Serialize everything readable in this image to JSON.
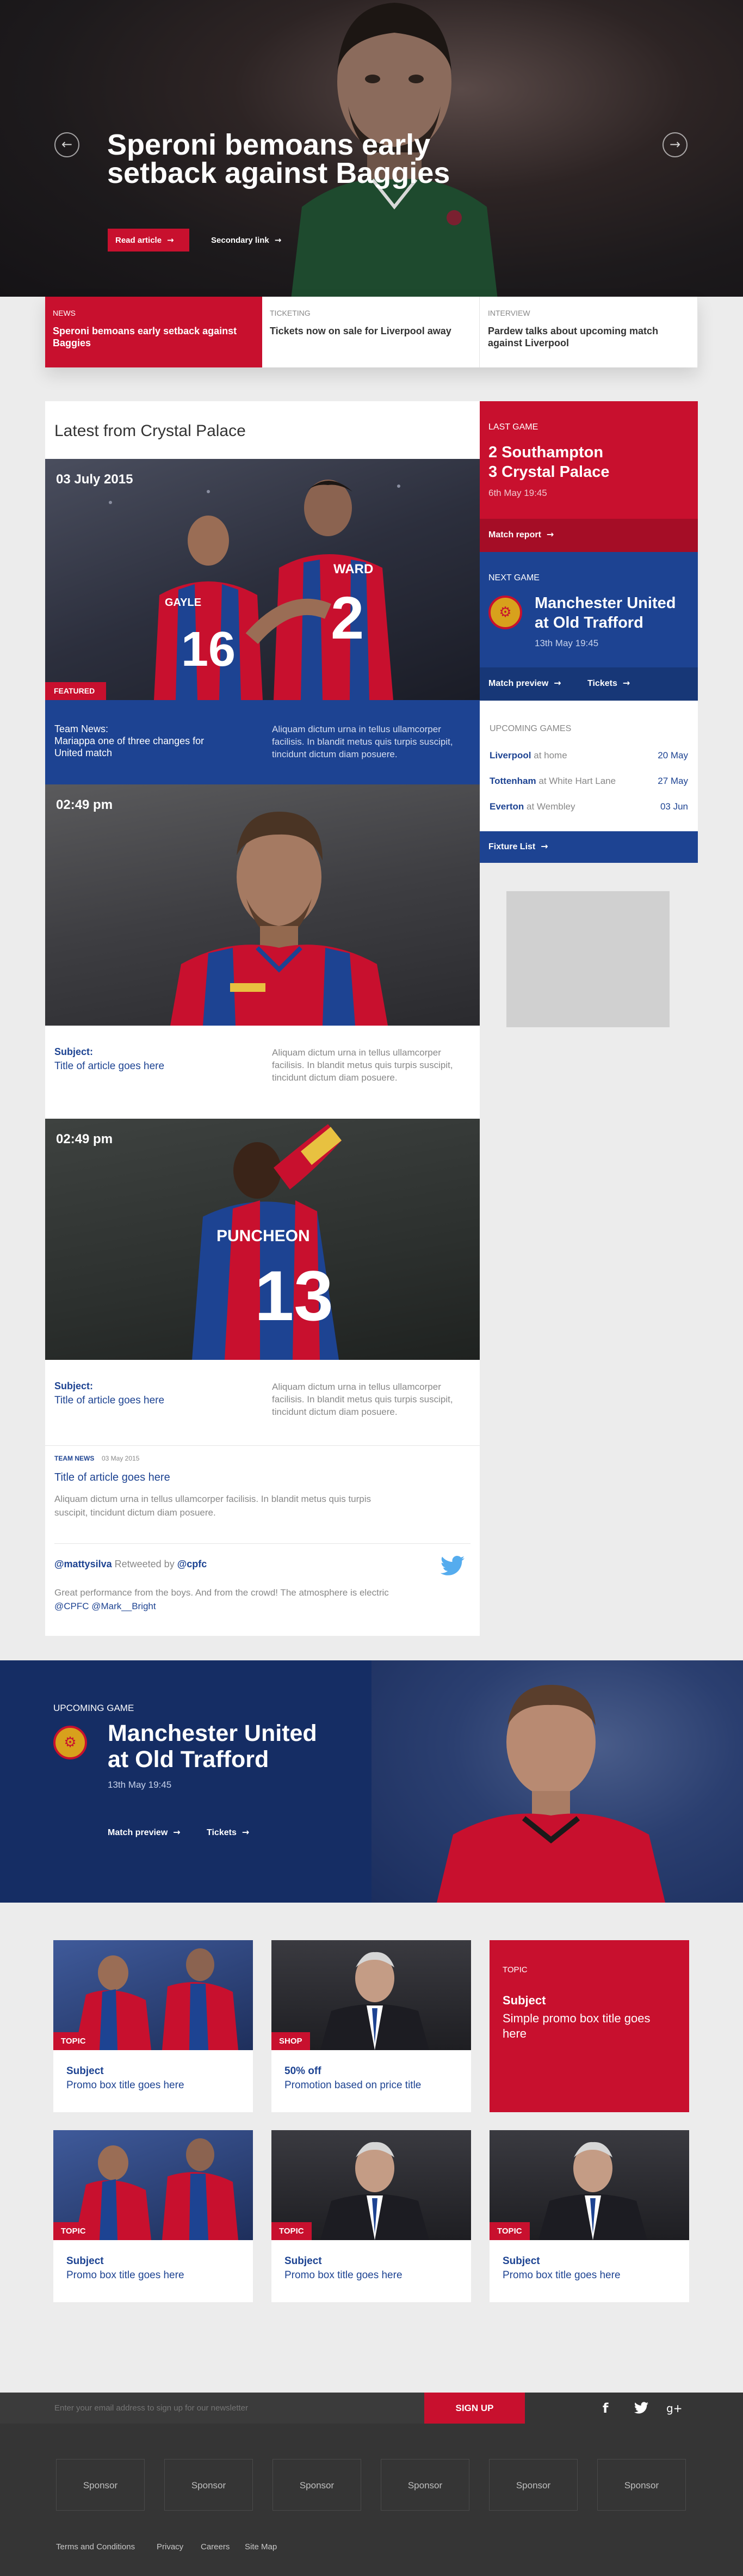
{
  "hero": {
    "title": "Speroni bemoans early setback against Baggies",
    "primary_cta": "Read article",
    "secondary_cta": "Secondary link",
    "prev_icon": "chevron-left-icon",
    "next_icon": "chevron-right-icon"
  },
  "news_strip": [
    {
      "category": "News",
      "text": "Speroni bemoans early setback against Baggies",
      "active": true
    },
    {
      "category": "Ticketing",
      "text": "Tickets now on sale for Liverpool away",
      "active": false
    },
    {
      "category": "Interview",
      "text": "Pardew talks about upcoming match against Liverpool",
      "active": false
    }
  ],
  "latest": {
    "heading": "Latest from Crystal Palace",
    "featured": {
      "date": "03 July 2015",
      "tag": "Featured",
      "title": "Team News:\nMariappa one of three changes for United match",
      "desc": "Aliquam dictum urna in tellus ullamcorper facilisis. In blandit metus quis turpis suscipit, tincidunt dictum diam posuere."
    },
    "articles": [
      {
        "time": "02:49 pm",
        "subject": "Subject:",
        "title": "Title of article goes here",
        "desc": "Aliquam dictum urna in tellus ullamcorper facilisis. In blandit metus quis turpis suscipit, tincidunt dictum diam posuere.",
        "shirt_number": "",
        "shirt_name": ""
      },
      {
        "time": "02:49 pm",
        "subject": "Subject:",
        "title": "Title of article goes here",
        "desc": "Aliquam dictum urna in tellus ullamcorper facilisis. In blandit metus quis turpis suscipit, tincidunt dictum diam posuere.",
        "shirt_number": "13",
        "shirt_name": "PUNCHEON"
      }
    ],
    "news_item": {
      "category": "TEAM NEWS",
      "date": "03 May 2015",
      "title": "Title of article goes here",
      "desc": "Aliquam dictum urna in tellus ullamcorper facilisis. In blandit metus quis turpis suscipit, tincidunt dictum diam posuere."
    },
    "tweet": {
      "user": "@mattysilva",
      "retweeted": "Retweeted by",
      "by": "@cpfc",
      "body": "Great performance from the boys. And from the crowd! The atmosphere is electric",
      "mentions": "@CPFC @Mark__Bright",
      "icon": "twitter-icon"
    },
    "featured_shirt": {
      "number": "2",
      "name": "WARD",
      "number2": "16",
      "name2": "GAYLE"
    }
  },
  "sidebar": {
    "last_game": {
      "label": "Last Game",
      "line1": "2 Southampton",
      "line2": "3 Crystal Palace",
      "date": "6th May 19:45",
      "cta": "Match report"
    },
    "next_game": {
      "label": "Next Game",
      "line1": "Manchester United",
      "line2": "at Old Trafford",
      "date": "13th May 19:45",
      "cta1": "Match preview",
      "cta2": "Tickets"
    },
    "upcoming": {
      "label": "Upcoming Games",
      "rows": [
        {
          "team": "Liverpool",
          "venue": "at home",
          "date": "20 May"
        },
        {
          "team": "Tottenham",
          "venue": "at White Hart Lane",
          "date": "27 May"
        },
        {
          "team": "Everton",
          "venue": "at Wembley",
          "date": "03 Jun"
        }
      ],
      "cta": "Fixture List"
    }
  },
  "banner": {
    "label": "Upcoming Game",
    "line1": "Manchester United",
    "line2": "at Old Trafford",
    "date": "13th May 19:45",
    "cta1": "Match preview",
    "cta2": "Tickets"
  },
  "promos": [
    {
      "tag": "Topic",
      "subject": "Subject",
      "title": "Promo box title goes here",
      "img": "players"
    },
    {
      "tag": "Shop",
      "subject": "50% off",
      "title": "Promotion based on price title",
      "img": "manager"
    },
    {
      "tag": "Topic",
      "subject": "Subject",
      "title": "Simple promo box title goes here",
      "img": "none"
    },
    {
      "tag": "Topic",
      "subject": "Subject",
      "title": "Promo box title goes here",
      "img": "players"
    },
    {
      "tag": "Topic",
      "subject": "Subject",
      "title": "Promo box title goes here",
      "img": "manager"
    },
    {
      "tag": "Topic",
      "subject": "Subject",
      "title": "Promo box title goes here",
      "img": "manager"
    }
  ],
  "newsletter": {
    "placeholder": "Enter your email address to sign up for our newsletter",
    "cta": "Sign up"
  },
  "social": [
    {
      "icon": "facebook-icon",
      "glyph": "f"
    },
    {
      "icon": "twitter-icon",
      "glyph": "t"
    },
    {
      "icon": "google-plus-icon",
      "glyph": "g+"
    }
  ],
  "sponsors": [
    "Sponsor",
    "Sponsor",
    "Sponsor",
    "Sponsor",
    "Sponsor",
    "Sponsor"
  ],
  "footer_links": [
    "Terms and Conditions",
    "Privacy",
    "Careers",
    "Site Map"
  ],
  "colors": {
    "red": "#c8102e",
    "blue": "#1d4392",
    "dark": "#353535"
  }
}
